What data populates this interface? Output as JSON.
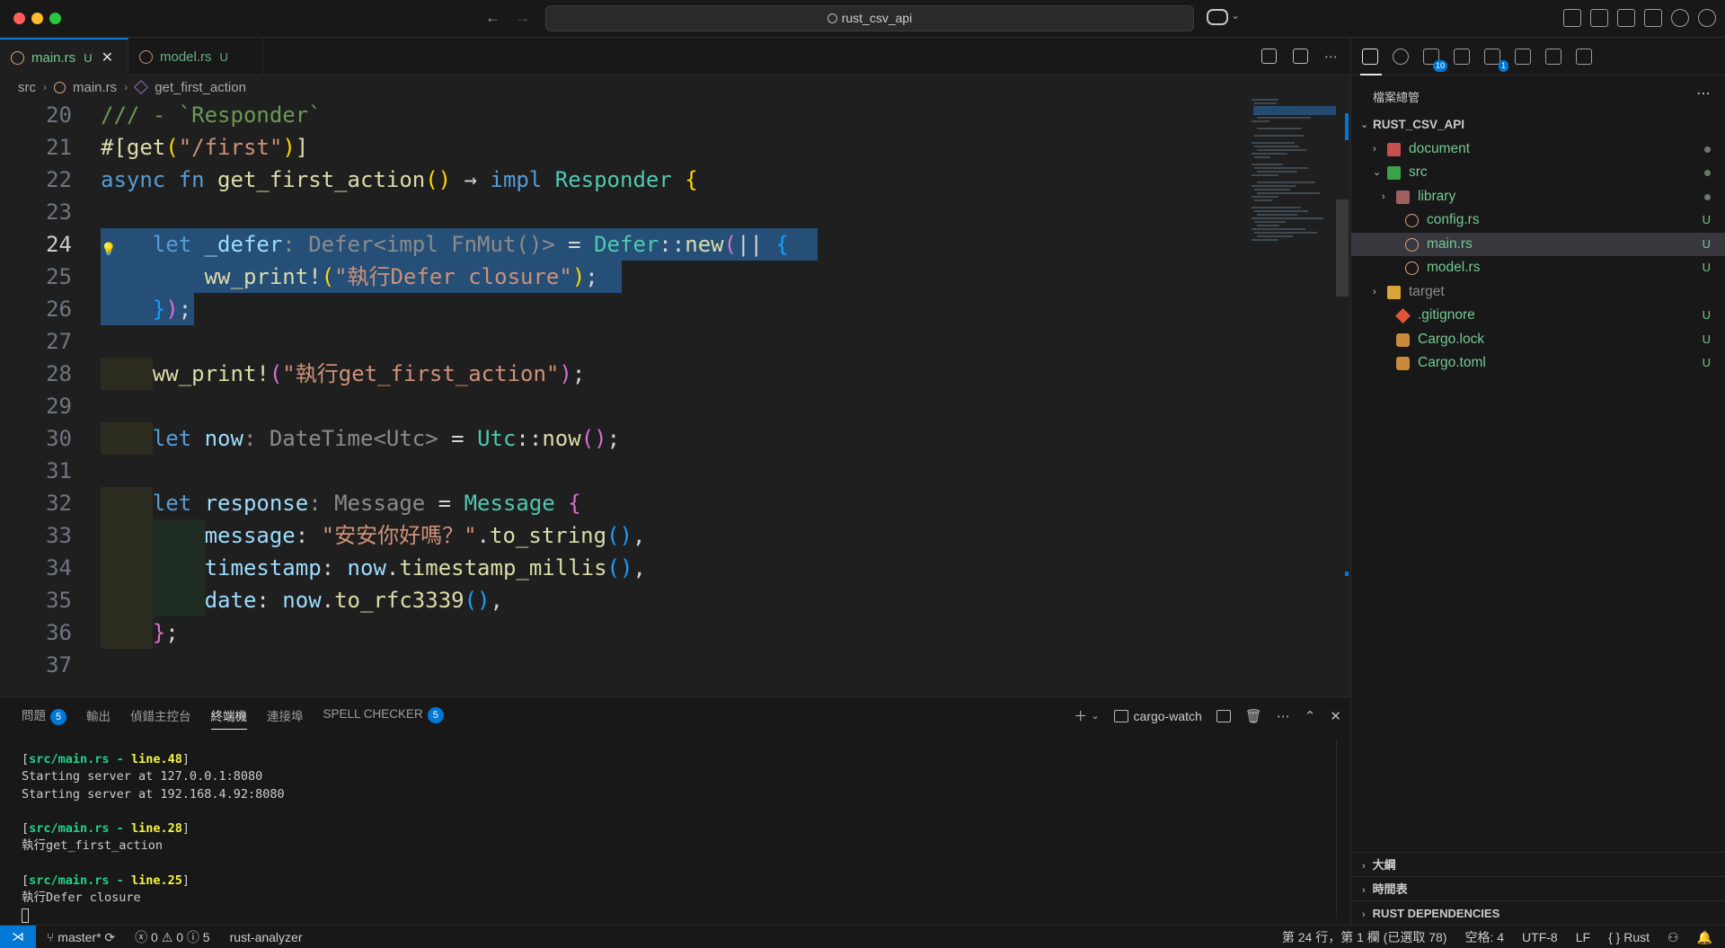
{
  "window": {
    "search_text": "rust_csv_api"
  },
  "tabs": [
    {
      "label": "main.rs",
      "status": "U"
    },
    {
      "label": "model.rs",
      "status": "U"
    }
  ],
  "breadcrumb": {
    "folder": "src",
    "file": "main.rs",
    "symbol": "get_first_action"
  },
  "code_lines": [
    {
      "num": "20",
      "tokens": [
        {
          "t": "/// - `Responder`",
          "c": "cm"
        }
      ]
    },
    {
      "num": "21",
      "tokens": [
        {
          "t": "#[",
          "c": "fn"
        },
        {
          "t": "get",
          "c": "fn"
        },
        {
          "t": "(",
          "c": "br1"
        },
        {
          "t": "\"/first\"",
          "c": "str"
        },
        {
          "t": ")",
          "c": "br1"
        },
        {
          "t": "]",
          "c": "fn"
        }
      ]
    },
    {
      "num": "22",
      "tokens": [
        {
          "t": "async fn ",
          "c": "kw"
        },
        {
          "t": "get_first_action",
          "c": "fn"
        },
        {
          "t": "()",
          "c": "br1"
        },
        {
          "t": " → ",
          "c": "punc"
        },
        {
          "t": "impl ",
          "c": "kw"
        },
        {
          "t": "Responder ",
          "c": "ty"
        },
        {
          "t": "{",
          "c": "br1"
        }
      ]
    },
    {
      "num": "23",
      "tokens": []
    },
    {
      "num": "24",
      "tokens": [
        {
          "t": "    let ",
          "c": "kw"
        },
        {
          "t": "_defer",
          "c": "var"
        },
        {
          "t": ": Defer<impl FnMut()>",
          "c": "hint"
        },
        {
          "t": " = ",
          "c": "punc"
        },
        {
          "t": "Defer",
          "c": "ty"
        },
        {
          "t": "::",
          "c": "punc"
        },
        {
          "t": "new",
          "c": "fn"
        },
        {
          "t": "(",
          "c": "br2"
        },
        {
          "t": "|| ",
          "c": "punc"
        },
        {
          "t": "{",
          "c": "br3"
        }
      ]
    },
    {
      "num": "25",
      "tokens": [
        {
          "t": "        ww_print!",
          "c": "mac"
        },
        {
          "t": "(",
          "c": "br1"
        },
        {
          "t": "\"執行Defer closure\"",
          "c": "str"
        },
        {
          "t": ")",
          "c": "br1"
        },
        {
          "t": ";",
          "c": "punc"
        }
      ]
    },
    {
      "num": "26",
      "tokens": [
        {
          "t": "    }",
          "c": "br3"
        },
        {
          "t": ")",
          "c": "br2"
        },
        {
          "t": ";",
          "c": "punc"
        }
      ]
    },
    {
      "num": "27",
      "tokens": []
    },
    {
      "num": "28",
      "tokens": [
        {
          "t": "    ww_print!",
          "c": "mac"
        },
        {
          "t": "(",
          "c": "br2"
        },
        {
          "t": "\"執行get_first_action\"",
          "c": "str"
        },
        {
          "t": ")",
          "c": "br2"
        },
        {
          "t": ";",
          "c": "punc"
        }
      ]
    },
    {
      "num": "29",
      "tokens": []
    },
    {
      "num": "30",
      "tokens": [
        {
          "t": "    let ",
          "c": "kw"
        },
        {
          "t": "now",
          "c": "var"
        },
        {
          "t": ": DateTime<Utc>",
          "c": "hint"
        },
        {
          "t": " = ",
          "c": "punc"
        },
        {
          "t": "Utc",
          "c": "ty"
        },
        {
          "t": "::",
          "c": "punc"
        },
        {
          "t": "now",
          "c": "fn"
        },
        {
          "t": "()",
          "c": "br2"
        },
        {
          "t": ";",
          "c": "punc"
        }
      ]
    },
    {
      "num": "31",
      "tokens": []
    },
    {
      "num": "32",
      "tokens": [
        {
          "t": "    let ",
          "c": "kw"
        },
        {
          "t": "response",
          "c": "var"
        },
        {
          "t": ": Message",
          "c": "hint"
        },
        {
          "t": " = ",
          "c": "punc"
        },
        {
          "t": "Message ",
          "c": "ty"
        },
        {
          "t": "{",
          "c": "br2"
        }
      ]
    },
    {
      "num": "33",
      "tokens": [
        {
          "t": "        message",
          "c": "var"
        },
        {
          "t": ": ",
          "c": "punc"
        },
        {
          "t": "\"安安你好嗎？\"",
          "c": "str"
        },
        {
          "t": ".",
          "c": "punc"
        },
        {
          "t": "to_string",
          "c": "fn"
        },
        {
          "t": "()",
          "c": "br3"
        },
        {
          "t": ",",
          "c": "punc"
        }
      ]
    },
    {
      "num": "34",
      "tokens": [
        {
          "t": "        timestamp",
          "c": "var"
        },
        {
          "t": ": ",
          "c": "punc"
        },
        {
          "t": "now",
          "c": "var"
        },
        {
          "t": ".",
          "c": "punc"
        },
        {
          "t": "timestamp_millis",
          "c": "fn"
        },
        {
          "t": "()",
          "c": "br3"
        },
        {
          "t": ",",
          "c": "punc"
        }
      ]
    },
    {
      "num": "35",
      "tokens": [
        {
          "t": "        date",
          "c": "var"
        },
        {
          "t": ": ",
          "c": "punc"
        },
        {
          "t": "now",
          "c": "var"
        },
        {
          "t": ".",
          "c": "punc"
        },
        {
          "t": "to_rfc3339",
          "c": "fn"
        },
        {
          "t": "()",
          "c": "br3"
        },
        {
          "t": ",",
          "c": "punc"
        }
      ]
    },
    {
      "num": "36",
      "tokens": [
        {
          "t": "    }",
          "c": "br2"
        },
        {
          "t": ";",
          "c": "punc"
        }
      ]
    },
    {
      "num": "37",
      "tokens": []
    }
  ],
  "current_line": "24",
  "panel": {
    "tabs": [
      {
        "label": "問題",
        "badge": "5"
      },
      {
        "label": "輸出",
        "badge": ""
      },
      {
        "label": "偵錯主控台",
        "badge": ""
      },
      {
        "label": "終端機",
        "badge": "",
        "active": true
      },
      {
        "label": "連接埠",
        "badge": ""
      },
      {
        "label": "SPELL CHECKER",
        "badge": "5"
      }
    ],
    "terminal_name": "cargo-watch",
    "terminal_lines": [
      {
        "path": "src/main.rs",
        "line": "line.48",
        "out": [
          "Starting server at 127.0.0.1:8080",
          "Starting server at 192.168.4.92:8080"
        ]
      },
      {
        "path": "src/main.rs",
        "line": "line.28",
        "out": [
          "執行get_first_action"
        ]
      },
      {
        "path": "src/main.rs",
        "line": "line.25",
        "out": [
          "執行Defer closure"
        ]
      }
    ]
  },
  "sidebar": {
    "title": "檔案總管",
    "root": "RUST_CSV_API",
    "activity_badges": {
      "source_control": "10",
      "extensions": "1"
    },
    "tree": [
      {
        "name": "document",
        "depth": 0,
        "type": "folder",
        "icon": "folder-red",
        "chev": "›",
        "dot": true,
        "status": "",
        "color": "green"
      },
      {
        "name": "src",
        "depth": 0,
        "type": "folder",
        "icon": "folder-green",
        "chev": "⌄",
        "dot": true,
        "status": "",
        "color": "green"
      },
      {
        "name": "library",
        "depth": 1,
        "type": "folder",
        "icon": "folder-lib",
        "chev": "›",
        "dot": true,
        "status": "",
        "color": "green"
      },
      {
        "name": "config.rs",
        "depth": 1,
        "type": "file",
        "icon": "rs-file",
        "chev": "",
        "dot": false,
        "status": "U",
        "color": "green"
      },
      {
        "name": "main.rs",
        "depth": 1,
        "type": "file",
        "icon": "rs-file",
        "chev": "",
        "dot": false,
        "status": "U",
        "color": "green",
        "selected": true
      },
      {
        "name": "model.rs",
        "depth": 1,
        "type": "file",
        "icon": "rs-file",
        "chev": "",
        "dot": false,
        "status": "U",
        "color": "green"
      },
      {
        "name": "target",
        "depth": 0,
        "type": "folder",
        "icon": "folder-yellow",
        "chev": "›",
        "dot": false,
        "status": "",
        "color": "gray"
      },
      {
        "name": ".gitignore",
        "depth": 0,
        "type": "file",
        "icon": "git-ic",
        "chev": "",
        "dot": false,
        "status": "U",
        "color": "green"
      },
      {
        "name": "Cargo.lock",
        "depth": 0,
        "type": "file",
        "icon": "cargo-ic",
        "chev": "",
        "dot": false,
        "status": "U",
        "color": "green"
      },
      {
        "name": "Cargo.toml",
        "depth": 0,
        "type": "file",
        "icon": "cargo-ic",
        "chev": "",
        "dot": false,
        "status": "U",
        "color": "green"
      }
    ],
    "sections": [
      "大綱",
      "時間表",
      "RUST DEPENDENCIES"
    ]
  },
  "status": {
    "branch": "master*",
    "errors": "0",
    "warnings": "0",
    "infos": "5",
    "analyzer": "rust-analyzer",
    "position": "第 24 行，第 1 欄 (已選取 78)",
    "spaces": "空格: 4",
    "encoding": "UTF-8",
    "eol": "LF",
    "language": "Rust"
  },
  "colors": {
    "accent": "#0078d4",
    "untracked": "#73c991",
    "selection": "#264f78"
  }
}
